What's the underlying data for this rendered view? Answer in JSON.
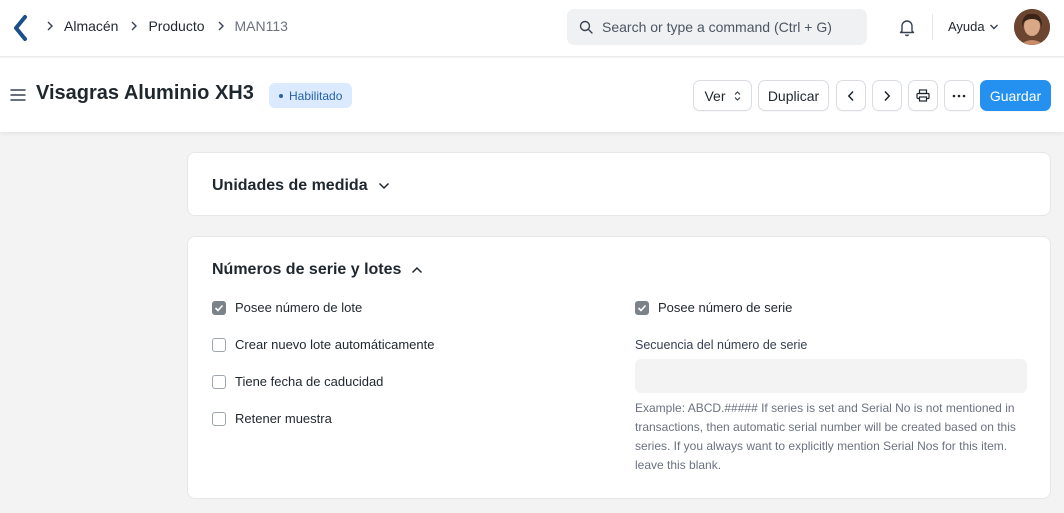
{
  "breadcrumbs": [
    "Almacén",
    "Producto",
    "MAN113"
  ],
  "search": {
    "placeholder": "Search or type a command (Ctrl + G)"
  },
  "help_label": "Ayuda",
  "page": {
    "title": "Visagras Aluminio XH3",
    "status": "Habilitado",
    "buttons": {
      "view": "Ver",
      "duplicate": "Duplicar",
      "save": "Guardar"
    }
  },
  "sections": {
    "units": {
      "title": "Unidades de medida"
    },
    "serial": {
      "title": "Números de serie y lotes",
      "checkboxes_left": [
        {
          "label": "Posee número de lote",
          "checked": true
        },
        {
          "label": "Crear nuevo lote automáticamente",
          "checked": false
        },
        {
          "label": "Tiene fecha de caducidad",
          "checked": false
        },
        {
          "label": "Retener muestra",
          "checked": false
        }
      ],
      "checkbox_right": {
        "label": "Posee número de serie",
        "checked": true
      },
      "sequence_label": "Secuencia del número de serie",
      "sequence_value": "",
      "sequence_help": "Example: ABCD.##### If series is set and Serial No is not mentioned in transactions, then automatic serial number will be created based on this series. If you always want to explicitly mention Serial Nos for this item. leave this blank."
    }
  },
  "colors": {
    "primary": "#2490ef",
    "badge_bg": "#dbeafe",
    "badge_text": "#2563a8"
  }
}
